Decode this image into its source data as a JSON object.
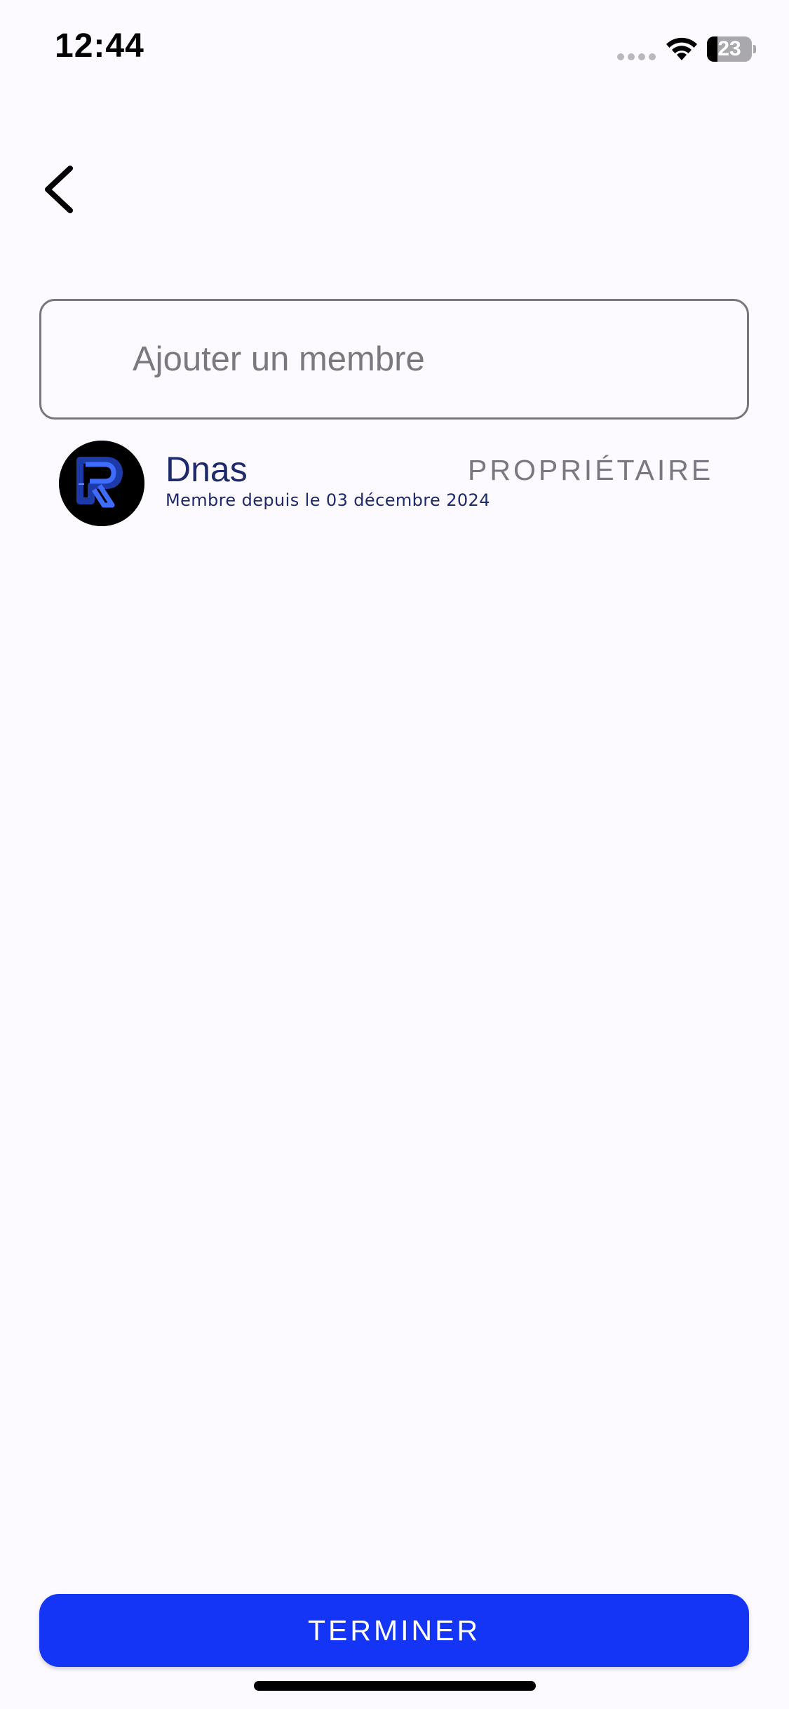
{
  "status_bar": {
    "time": "12:44",
    "battery_percent": "23",
    "battery_level": 0.23
  },
  "icons": {
    "back": "chevron-left-icon",
    "wifi": "wifi-icon",
    "signal": "cellular-signal-icon",
    "battery": "battery-icon",
    "avatar": "avatar-logo"
  },
  "add_member": {
    "placeholder": "Ajouter un membre",
    "value": ""
  },
  "members": [
    {
      "name": "Dnas",
      "since": "Membre depuis le 03 décembre 2024",
      "role": "PROPRIÉTAIRE"
    }
  ],
  "finish_button": {
    "label": "TERMINER"
  },
  "colors": {
    "background": "#fcfaff",
    "primary": "#1535f6",
    "member_text": "#1e2a6b",
    "role_text": "#7a7780",
    "input_border": "#79747e"
  }
}
